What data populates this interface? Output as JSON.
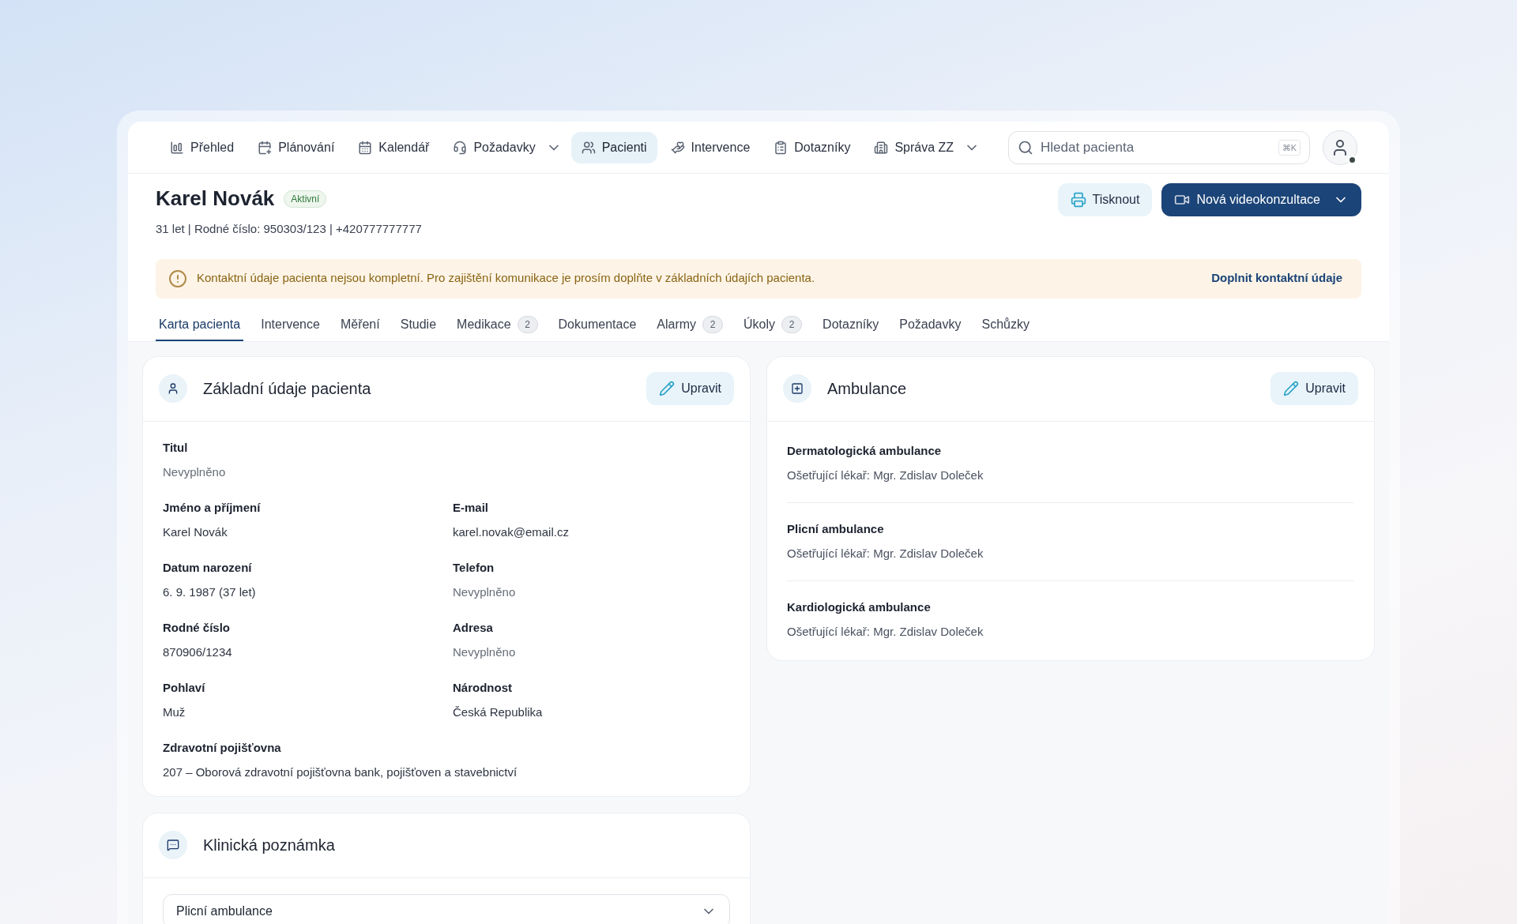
{
  "nav": {
    "items": [
      {
        "label": "Přehled",
        "selected": false,
        "has_dropdown": false
      },
      {
        "label": "Plánování",
        "selected": false,
        "has_dropdown": false
      },
      {
        "label": "Kalendář",
        "selected": false,
        "has_dropdown": false
      },
      {
        "label": "Požadavky",
        "selected": false,
        "has_dropdown": true
      },
      {
        "label": "Pacienti",
        "selected": true,
        "has_dropdown": false
      },
      {
        "label": "Intervence",
        "selected": false,
        "has_dropdown": false
      },
      {
        "label": "Dotazníky",
        "selected": false,
        "has_dropdown": false
      },
      {
        "label": "Správa ZZ",
        "selected": false,
        "has_dropdown": true
      }
    ],
    "search": {
      "placeholder": "Hledat pacienta",
      "shortcut": "⌘K"
    },
    "user": {
      "online": true
    }
  },
  "patient": {
    "name": "Karel Novák",
    "status": "Aktivní",
    "details": "31 let | Rodné číslo: 950303/123 | +420777777777"
  },
  "actions": {
    "print": "Tisknout",
    "video": "Nová videokonzultace"
  },
  "alert": {
    "message": "Kontaktní údaje pacienta nejsou kompletní. Pro zajištění komunikace je prosím doplňte v základních údajích pacienta.",
    "link": "Doplnit kontaktní údaje"
  },
  "tabs": [
    {
      "label": "Karta pacienta",
      "selected": true
    },
    {
      "label": "Intervence",
      "selected": false
    },
    {
      "label": "Měření",
      "selected": false
    },
    {
      "label": "Studie",
      "selected": false
    },
    {
      "label": "Medikace",
      "selected": false,
      "badge": "2"
    },
    {
      "label": "Dokumentace",
      "selected": false
    },
    {
      "label": "Alarmy",
      "selected": false,
      "badge": "2"
    },
    {
      "label": "Úkoly",
      "selected": false,
      "badge": "2"
    },
    {
      "label": "Dotazníky",
      "selected": false
    },
    {
      "label": "Požadavky",
      "selected": false
    },
    {
      "label": "Schůzky",
      "selected": false
    }
  ],
  "basic_info": {
    "title": "Základní údaje pacienta",
    "edit": "Upravit",
    "rows": [
      [
        {
          "label": "Titul",
          "value": "Nevyplněno",
          "empty": true
        }
      ],
      [
        {
          "label": "Jméno a příjmení",
          "value": "Karel Novák",
          "empty": false
        },
        {
          "label": "E-mail",
          "value": "karel.novak@email.cz",
          "empty": false
        }
      ],
      [
        {
          "label": "Datum narození",
          "value": "6. 9. 1987 (37 let)",
          "empty": false
        },
        {
          "label": "Telefon",
          "value": "Nevyplněno",
          "empty": true
        }
      ],
      [
        {
          "label": "Rodné číslo",
          "value": "870906/1234",
          "empty": false
        },
        {
          "label": "Adresa",
          "value": "Nevyplněno",
          "empty": true
        }
      ],
      [
        {
          "label": "Pohlaví",
          "value": "Muž",
          "empty": false
        },
        {
          "label": "Národnost",
          "value": "Česká Republika",
          "empty": false
        }
      ],
      [
        {
          "label": "Zdravotní pojišťovna",
          "value": "207 – Oborová zdravotní pojišťovna bank, pojišťoven a stavebnictví",
          "empty": false
        }
      ]
    ]
  },
  "ambulance": {
    "title": "Ambulance",
    "edit": "Upravit",
    "items": [
      {
        "name": "Dermatologická ambulance",
        "doctor": "Ošetřující lékař: Mgr. Zdislav Doleček"
      },
      {
        "name": "Plicní ambulance",
        "doctor": "Ošetřující lékař: Mgr. Zdislav Doleček"
      },
      {
        "name": "Kardiologická ambulance",
        "doctor": "Ošetřující lékař: Mgr. Zdislav Doleček"
      }
    ]
  },
  "clinical_note": {
    "title": "Klinická poznámka",
    "select": {
      "value": "Plicní ambulance"
    }
  }
}
